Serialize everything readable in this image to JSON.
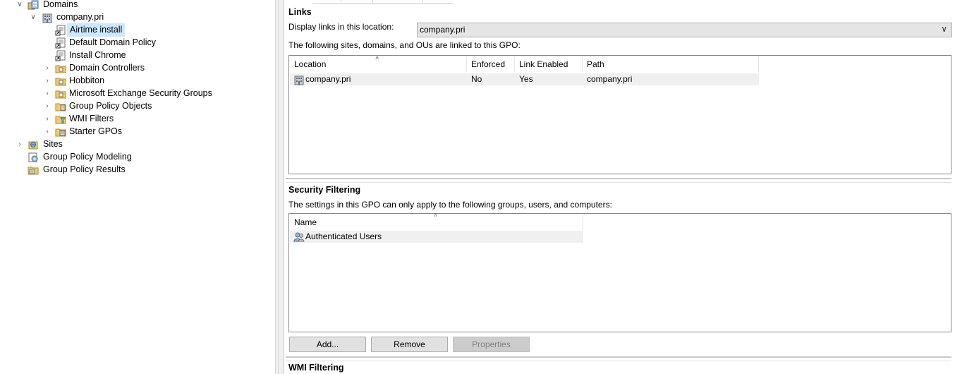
{
  "tree": {
    "domains": "Domains",
    "company": "company.pri",
    "items": [
      {
        "label": "Airtime install",
        "selected": true,
        "icon": "gpo-link-icon"
      },
      {
        "label": "Default Domain Policy",
        "icon": "gpo-link-icon"
      },
      {
        "label": "Install Chrome",
        "icon": "gpo-link-icon"
      },
      {
        "label": "Domain Controllers",
        "icon": "ou-folder-icon"
      },
      {
        "label": "Hobbiton",
        "icon": "ou-folder-icon"
      },
      {
        "label": "Microsoft Exchange Security Groups",
        "icon": "ou-folder-icon"
      },
      {
        "label": "Group Policy Objects",
        "icon": "gpo-folder-icon"
      },
      {
        "label": "WMI Filters",
        "icon": "wmi-folder-icon"
      },
      {
        "label": "Starter GPOs",
        "icon": "starter-folder-icon"
      }
    ],
    "sites": "Sites",
    "modeling": "Group Policy Modeling",
    "results": "Group Policy Results"
  },
  "links": {
    "title": "Links",
    "display_label": "Display links in this location:",
    "location_value": "company.pri",
    "description": "The following sites, domains, and OUs are linked to this GPO:",
    "columns": [
      "Location",
      "Enforced",
      "Link Enabled",
      "Path"
    ],
    "rows": [
      {
        "location": "company.pri",
        "enforced": "No",
        "link_enabled": "Yes",
        "path": "company.pri"
      }
    ]
  },
  "security": {
    "title": "Security Filtering",
    "description": "The settings in this GPO can only apply to the following groups, users, and computers:",
    "column": "Name",
    "rows": [
      "Authenticated Users"
    ],
    "add": "Add...",
    "remove": "Remove",
    "properties": "Properties"
  },
  "wmi": {
    "title": "WMI Filtering"
  }
}
